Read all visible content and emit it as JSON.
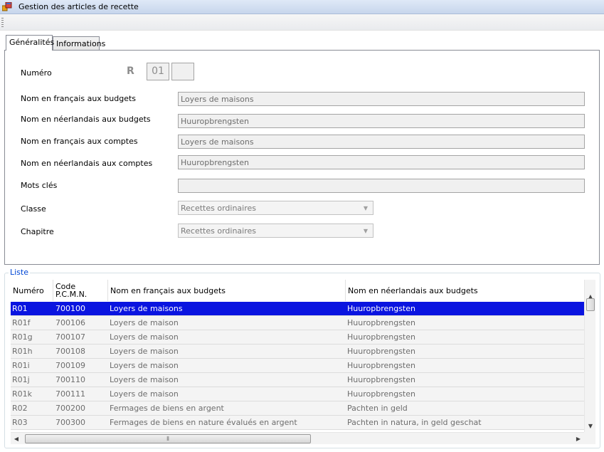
{
  "window": {
    "title": "Gestion des articles de recette"
  },
  "tabs": [
    {
      "label": "Généralités",
      "active": true
    },
    {
      "label": "Informations",
      "active": false
    }
  ],
  "form": {
    "numero": {
      "label": "Numéro",
      "prefix": "R",
      "part1": "01",
      "part2": ""
    },
    "nom_fr_budgets": {
      "label": "Nom en français aux budgets",
      "value": "Loyers de maisons"
    },
    "nom_nl_budgets": {
      "label": "Nom en néerlandais aux budgets",
      "value": "Huuropbrengsten"
    },
    "nom_fr_comptes": {
      "label": "Nom en français aux comptes",
      "value": "Loyers de maisons"
    },
    "nom_nl_comptes": {
      "label": "Nom en néerlandais aux comptes",
      "value": "Huuropbrengsten"
    },
    "mots_cles": {
      "label": "Mots clés",
      "value": ""
    },
    "classe": {
      "label": "Classe",
      "value": "Recettes ordinaires"
    },
    "chapitre": {
      "label": "Chapitre",
      "value": "Recettes ordinaires"
    }
  },
  "liste": {
    "title": "Liste",
    "columns": {
      "numero": "Numéro",
      "code_line1": "Code",
      "code_line2": "P.C.M.N.",
      "nom_fr": "Nom en français aux budgets",
      "nom_nl": "Nom en néerlandais aux budgets"
    },
    "rows": [
      {
        "numero": "R01",
        "code": "700100",
        "nom_fr": "Loyers de maisons",
        "nom_nl": "Huuropbrengsten",
        "selected": true
      },
      {
        "numero": "R01f",
        "code": "700106",
        "nom_fr": "Loyers de maison",
        "nom_nl": "Huuropbrengsten"
      },
      {
        "numero": "R01g",
        "code": "700107",
        "nom_fr": "Loyers de maison",
        "nom_nl": "Huuropbrengsten"
      },
      {
        "numero": "R01h",
        "code": "700108",
        "nom_fr": "Loyers de maison",
        "nom_nl": "Huuropbrengsten"
      },
      {
        "numero": "R01i",
        "code": "700109",
        "nom_fr": "Loyers de maison",
        "nom_nl": "Huuropbrengsten"
      },
      {
        "numero": "R01j",
        "code": "700110",
        "nom_fr": "Loyers de maison",
        "nom_nl": "Huuropbrengsten"
      },
      {
        "numero": "R01k",
        "code": "700111",
        "nom_fr": "Loyers de maison",
        "nom_nl": "Huuropbrengsten"
      },
      {
        "numero": "R02",
        "code": "700200",
        "nom_fr": "Fermages de biens en argent",
        "nom_nl": "Pachten in geld"
      },
      {
        "numero": "R03",
        "code": "700300",
        "nom_fr": "Fermages de biens en nature évalués en argent",
        "nom_nl": "Pachten in natura, in geld geschat"
      }
    ]
  },
  "colors": {
    "selection": "#0a14e0",
    "group_title": "#0046d5"
  }
}
